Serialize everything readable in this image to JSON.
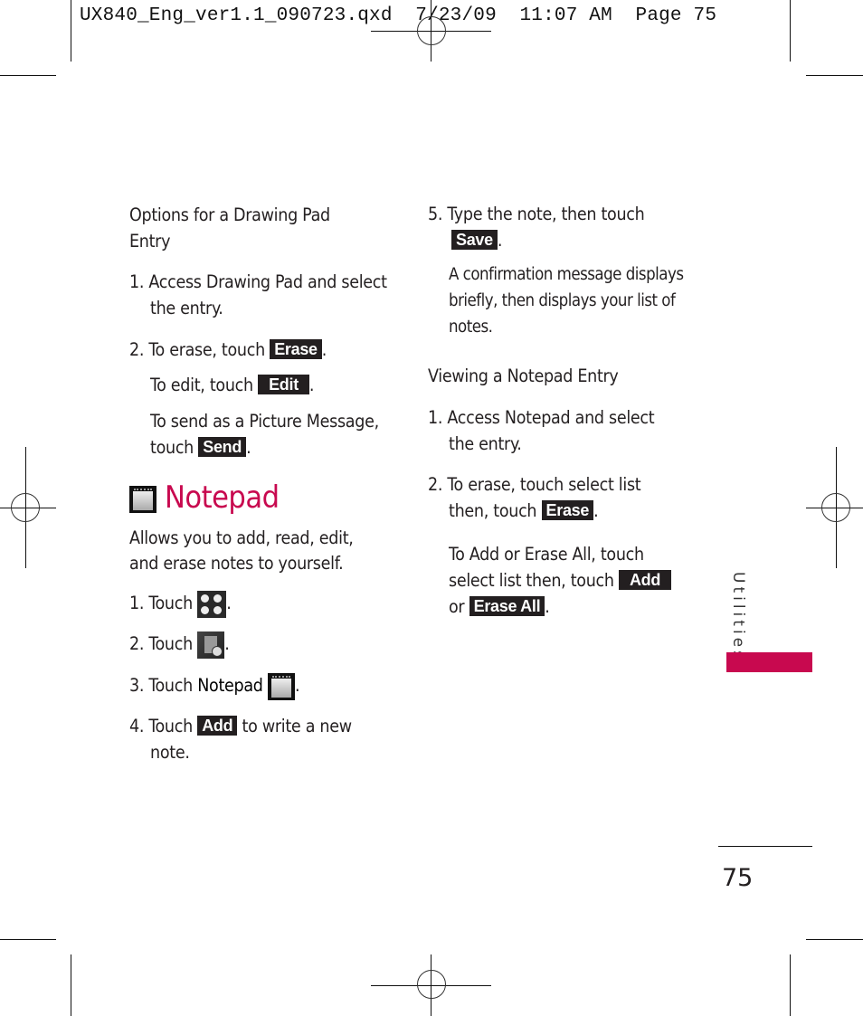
{
  "slug": {
    "file": "UX840_Eng_ver1.1_090723.qxd",
    "date": "7/23/09",
    "time": "11:07 AM",
    "page": "Page 75"
  },
  "left": {
    "section_heading_l1": "Options for a Drawing Pad",
    "section_heading_l2": "Entry",
    "step1_l1": "1. Access Drawing Pad and select",
    "step1_l2": "the entry.",
    "step2_pre": "2. To erase, touch ",
    "step2_btn": "Erase",
    "edit_pre": "To edit, touch ",
    "edit_btn": "Edit",
    "send_l1": "To send as a Picture Message,",
    "send_pre": "touch ",
    "send_btn": "Send",
    "notepad_title": "Notepad",
    "desc_l1": "Allows you to add, read, edit,",
    "desc_l2": "and erase notes to yourself.",
    "np_step1": "1. Touch ",
    "np_step2": "2. Touch ",
    "np_step3_pre": "3. Touch ",
    "np_step3_bold": "Notepad",
    "np_step4_pre": "4. Touch ",
    "np_step4_btn": "Add",
    "np_step4_post": " to write a new",
    "np_step4_l2": "note.",
    "period": "."
  },
  "right": {
    "step5_l1": "5. Type the note, then touch",
    "step5_btn": "Save",
    "confirm_l1": "A confirmation message displays",
    "confirm_l2": "briefly, then displays your list of",
    "confirm_l3": "notes.",
    "view_heading": "Viewing a Notepad Entry",
    "v_step1_l1": "1. Access Notepad and select",
    "v_step1_l2": "the entry.",
    "v_step2_l1": "2. To erase, touch select list",
    "v_step2_pre": "then, touch ",
    "v_step2_btn": "Erase",
    "addall_l1": "To Add or Erase All, touch",
    "addall_pre": "select list then, touch ",
    "addall_btn1": "Add",
    "addall_or": "or ",
    "addall_btn2": "Erase All",
    "period": "."
  },
  "side_tab": {
    "label": "Utilities",
    "color": "#c8094f"
  },
  "page_number": "75",
  "colors": {
    "accent": "#c8094f",
    "button_bg": "#231f20"
  },
  "icons": [
    "notepad-icon",
    "menu-grid-icon",
    "multimedia-icon"
  ]
}
